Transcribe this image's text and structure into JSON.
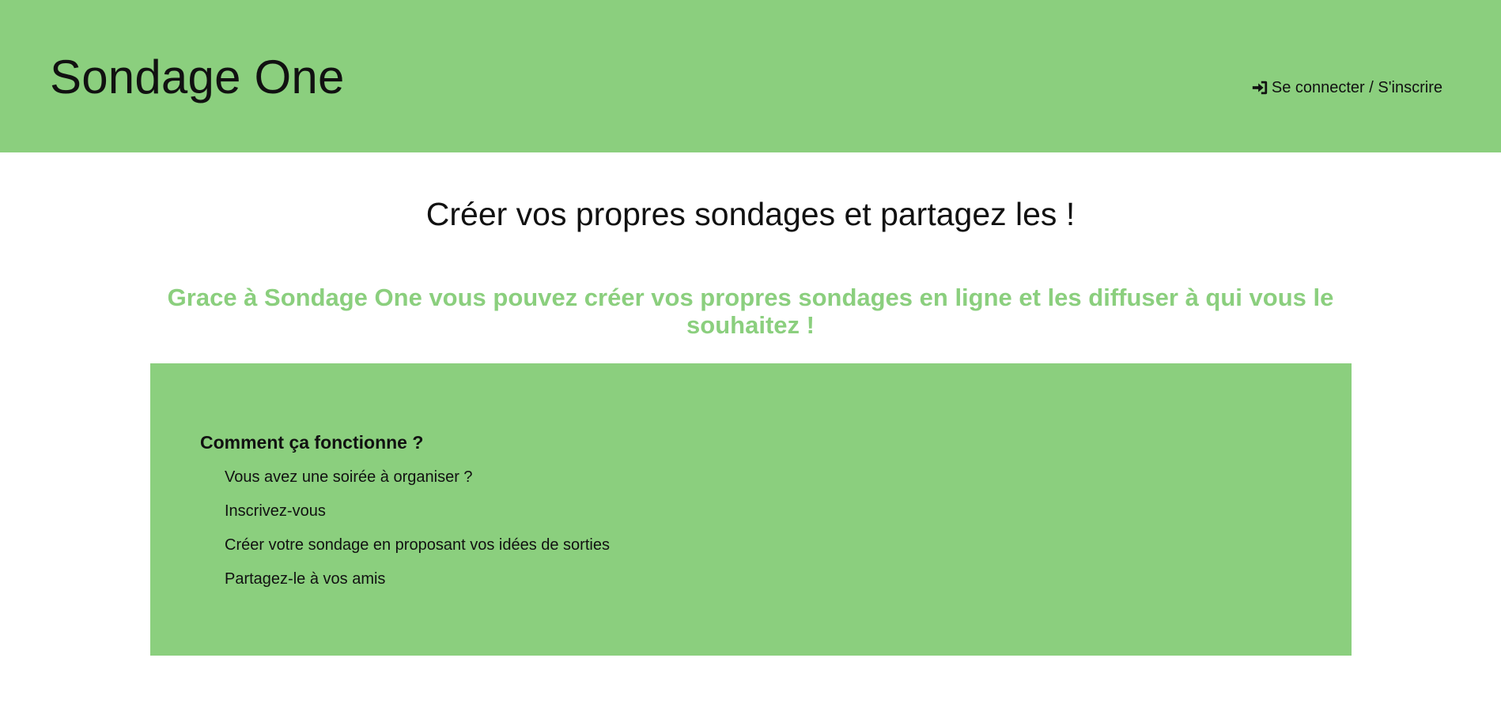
{
  "header": {
    "brand": "Sondage One",
    "login_link": {
      "label": "Se connecter / S'inscrire",
      "icon": "sign-in-icon"
    }
  },
  "hero": {
    "title": "Créer vos propres sondages et partagez les !",
    "subtitle": "Grace à Sondage One vous pouvez créer vos propres sondages en ligne et les diffuser à qui vous le souhaitez !"
  },
  "info": {
    "title": "Comment ça fonctionne ?",
    "steps": [
      "Vous avez une soirée à organiser ?",
      "Inscrivez-vous",
      "Créer votre sondage en proposant vos idées de sorties",
      "Partagez-le à vos amis"
    ]
  },
  "colors": {
    "accent_green": "#8bcf7e",
    "text_dark": "#111111",
    "background": "#ffffff"
  }
}
